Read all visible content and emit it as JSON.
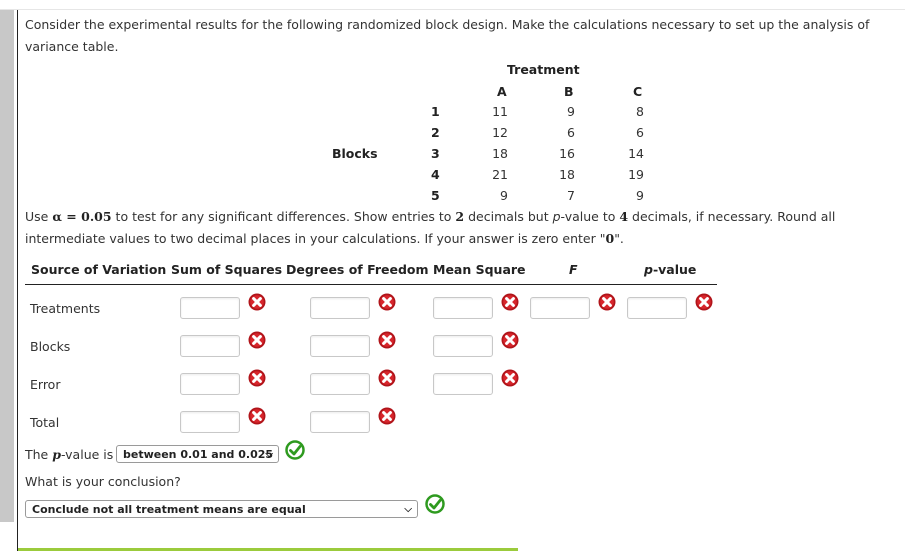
{
  "intro": "Consider the experimental results for the following randomized block design. Make the calculations necessary to set up the analysis of variance table.",
  "data_table": {
    "treatment_header": "Treatment",
    "blocks_label": "Blocks",
    "columns": [
      "A",
      "B",
      "C"
    ],
    "rows": [
      {
        "block": "1",
        "values": [
          "11",
          "9",
          "8"
        ]
      },
      {
        "block": "2",
        "values": [
          "12",
          "6",
          "6"
        ]
      },
      {
        "block": "3",
        "values": [
          "18",
          "16",
          "14"
        ]
      },
      {
        "block": "4",
        "values": [
          "21",
          "18",
          "19"
        ]
      },
      {
        "block": "5",
        "values": [
          "9",
          "7",
          "9"
        ]
      }
    ]
  },
  "instructions": {
    "p1": "Use ",
    "alpha": "α = 0.05",
    "p2": " to test for any significant differences. Show entries to ",
    "two": "2",
    "p3": " decimals but ",
    "pvar": "p",
    "p4": "-value to ",
    "four": "4",
    "p5": " decimals, if necessary. Round all intermediate values to two decimal places in your calculations. If your answer is zero enter \"",
    "zero": "0",
    "p6": "\"."
  },
  "anova": {
    "headers": {
      "source": "Source of Variation",
      "ss": "Sum of Squares",
      "df": "Degrees of Freedom",
      "ms": "Mean Square",
      "f": "F",
      "p_italic": "p",
      "p_rest": "-value"
    },
    "rows": [
      {
        "label": "Treatments",
        "ss": "",
        "df": "",
        "ms": "",
        "f": "",
        "p": "",
        "status": "incorrect"
      },
      {
        "label": "Blocks",
        "ss": "",
        "df": "",
        "ms": "",
        "status": "incorrect"
      },
      {
        "label": "Error",
        "ss": "",
        "df": "",
        "ms": "",
        "status": "incorrect"
      },
      {
        "label": "Total",
        "ss": "",
        "df": "",
        "status": "incorrect"
      }
    ]
  },
  "pvalue_question": {
    "prefix": "The ",
    "pvar": "p",
    "suffix": "-value is",
    "selected": "between 0.01 and 0.025",
    "status": "correct"
  },
  "conclusion_question": {
    "label": "What is your conclusion?",
    "selected": "Conclude not all treatment means are equal",
    "status": "correct"
  },
  "colors": {
    "incorrect": "#c0161c",
    "correct": "#2e9a1f",
    "progress_bar": "#9bcb3c"
  }
}
